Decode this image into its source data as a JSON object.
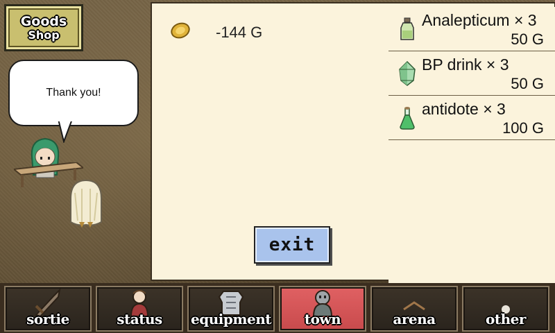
{
  "shop_sign": {
    "line1": "Goods",
    "line2": "Shop"
  },
  "speech": "Thank you!",
  "purchase": {
    "total": "-144 G",
    "icon": "gold-coin-icon"
  },
  "receipt": [
    {
      "name": "Analepticum × 3",
      "price": "50 G",
      "icon": "bottle-icon"
    },
    {
      "name": "BP drink × 3",
      "price": "50 G",
      "icon": "crystal-icon"
    },
    {
      "name": "antidote × 3",
      "price": "100 G",
      "icon": "flask-icon"
    }
  ],
  "exit_label": "exit",
  "nav": [
    {
      "label": "sortie",
      "icon": "sword-icon",
      "active": false
    },
    {
      "label": "status",
      "icon": "character-icon",
      "active": false
    },
    {
      "label": "equipment",
      "icon": "armor-icon",
      "active": false
    },
    {
      "label": "town",
      "icon": "townsfolk-icon",
      "active": true
    },
    {
      "label": "arena",
      "icon": "arena-icon",
      "active": false
    },
    {
      "label": "other",
      "icon": "other-icon",
      "active": false
    }
  ],
  "colors": {
    "panel": "#fbf3dc",
    "active_tab": "#d95557",
    "exit_button": "#a9c3ec",
    "sign": "#c9bf6f"
  }
}
